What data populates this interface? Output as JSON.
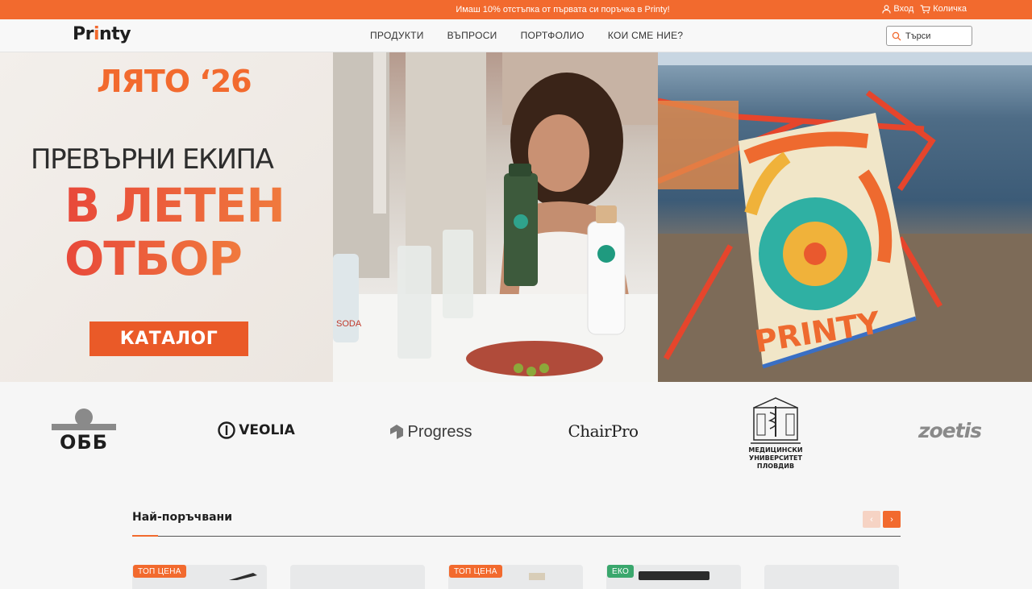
{
  "promo": {
    "message": "Имаш 10% отстъпка от първата си поръчка в Printy!",
    "login_label": "Вход",
    "cart_label": "Количка"
  },
  "header": {
    "logo_text": "Printy",
    "nav": [
      "ПРОДУКТИ",
      "ВЪПРОСИ",
      "ПОРТФОЛИО",
      "КОИ СМЕ НИЕ?"
    ],
    "search_placeholder": "Търси"
  },
  "hero": {
    "season": "ЛЯТО ‘26",
    "line1": "ПРЕВЪРНИ ЕКИПА",
    "line2": "В ЛЕТЕН",
    "line3": "ОТБОР",
    "cta_label": "КАТАЛОГ",
    "bottle_label": "SODA",
    "towel_text": "PRINTY"
  },
  "clients": {
    "logos": [
      "ОББ",
      "VEOLIA",
      "Progress",
      "ChairPro",
      "МЕДИЦИНСКИ УНИВЕРСИТЕТ ПЛОВДИВ",
      "zoetis"
    ],
    "mu_line1": "МЕДИЦИНСКИ",
    "mu_line2": "УНИВЕРСИТЕТ",
    "mu_line3": "ПЛОВДИВ"
  },
  "products": {
    "title": "Най-поръчвани",
    "prev_label": "‹",
    "next_label": "›",
    "badges": [
      "ТОП ЦЕНА",
      "ТОП ЦЕНА",
      "ЕКО"
    ]
  },
  "colors": {
    "accent": "#f26a2e",
    "eco": "#3aa76d"
  }
}
